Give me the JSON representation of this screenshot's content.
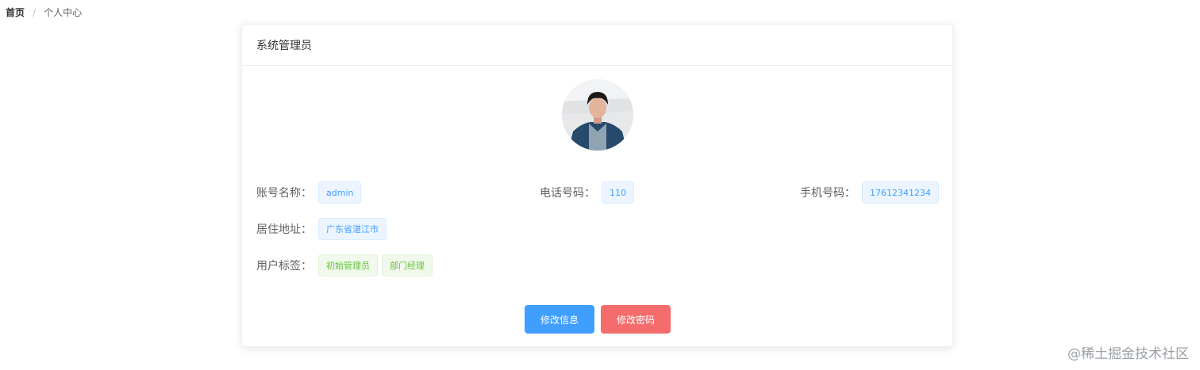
{
  "breadcrumb": {
    "home": "首页",
    "separator": "/",
    "current": "个人中心"
  },
  "card": {
    "title": "系统管理员"
  },
  "avatar": {
    "alt": "用户头像"
  },
  "fields": {
    "account": {
      "label": "账号名称：",
      "value": "admin"
    },
    "phone": {
      "label": "电话号码：",
      "value": "110"
    },
    "mobile": {
      "label": "手机号码：",
      "value": "17612341234"
    },
    "address": {
      "label": "居住地址：",
      "value": "广东省湛江市"
    },
    "tags": {
      "label": "用户标签：",
      "values": [
        "初始管理员",
        "部门经理"
      ]
    }
  },
  "actions": {
    "edit_info": "修改信息",
    "change_password": "修改密码"
  },
  "watermark": "@稀土掘金技术社区",
  "colors": {
    "primary": "#409eff",
    "danger": "#f56c6c",
    "success": "#67c23a"
  }
}
